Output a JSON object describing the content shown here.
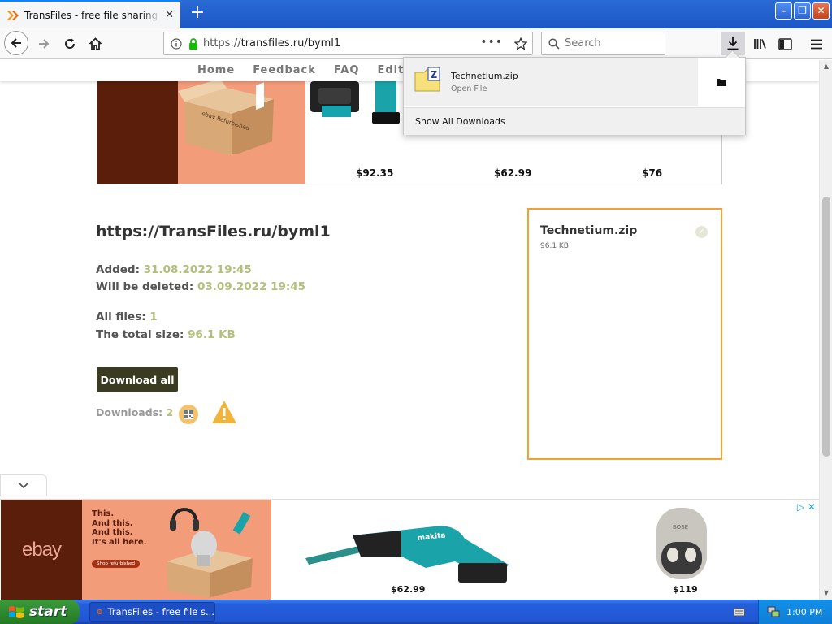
{
  "browser": {
    "tab_title": "TransFiles - free file sharing service",
    "url_prefix": "https://",
    "url_host": "transfiles.ru/byml1",
    "search_placeholder": "Search"
  },
  "site_nav": {
    "items": [
      "Home",
      "Feedback",
      "FAQ",
      "Editor"
    ]
  },
  "top_ad": {
    "box_label": "ebay Refurbished",
    "prices": [
      "$92.35",
      "$62.99",
      "$76"
    ]
  },
  "file_page": {
    "link": "https://TransFiles.ru/byml1",
    "added_label": "Added:",
    "added_value": "31.08.2022 19:45",
    "deleted_label": "Will be deleted:",
    "deleted_value": "03.09.2022 19:45",
    "all_files_label": "All files:",
    "all_files_value": "1",
    "total_size_label": "The total size:",
    "total_size_value": "96.1 KB",
    "download_all_label": "Download all",
    "downloads_label": "Downloads:",
    "downloads_value": "2"
  },
  "file_panel": {
    "name": "Technetium.zip",
    "size": "96.1 KB"
  },
  "download_popup": {
    "file_name": "Technetium.zip",
    "status": "Open File",
    "show_all": "Show All Downloads"
  },
  "bottom_ad": {
    "logo": "ebay",
    "tagline": [
      "This.",
      "And this.",
      "And this.",
      "It's all here."
    ],
    "shop_label": "Shop refurbished",
    "prices": [
      "$62.99",
      "$119"
    ]
  },
  "taskbar": {
    "start_label": "start",
    "task_label": "TransFiles - free file s...",
    "clock": "1:00 PM"
  },
  "colors": {
    "accent_olive": "#b5bf7c",
    "button_dark": "#3b3b22",
    "panel_border": "#f0a330",
    "ebay_brown": "#5a1e0a",
    "ebay_salmon": "#f39c7a"
  }
}
